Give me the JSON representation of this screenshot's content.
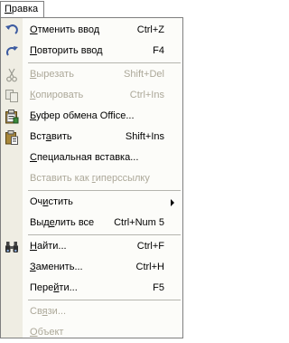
{
  "menu_title": "Правка",
  "menu_title_accel": "П",
  "menu_title_rest": "равка",
  "items": [
    {
      "type": "item",
      "pre": "",
      "accel": "О",
      "post": "тменить ввод",
      "shortcut": "Ctrl+Z",
      "icon": "undo-icon",
      "enabled": true
    },
    {
      "type": "item",
      "pre": "",
      "accel": "П",
      "post": "овторить ввод",
      "shortcut": "F4",
      "icon": "redo-icon",
      "enabled": true
    },
    {
      "type": "sep"
    },
    {
      "type": "item",
      "pre": "",
      "accel": "В",
      "post": "ырезать",
      "shortcut": "Shift+Del",
      "icon": "cut-icon",
      "enabled": false
    },
    {
      "type": "item",
      "pre": "",
      "accel": "К",
      "post": "опировать",
      "shortcut": "Ctrl+Ins",
      "icon": "copy-icon",
      "enabled": false
    },
    {
      "type": "item",
      "pre": "",
      "accel": "Б",
      "post": "уфер обмена Office...",
      "shortcut": "",
      "icon": "clipboard-icon",
      "enabled": true
    },
    {
      "type": "item",
      "pre": "Вст",
      "accel": "а",
      "post": "вить",
      "shortcut": "Shift+Ins",
      "icon": "paste-icon",
      "enabled": true
    },
    {
      "type": "item",
      "pre": "",
      "accel": "С",
      "post": "пециальная вставка...",
      "shortcut": "",
      "icon": "",
      "enabled": true
    },
    {
      "type": "item",
      "pre": "Вставить как ",
      "accel": "г",
      "post": "иперссылку",
      "shortcut": "",
      "icon": "",
      "enabled": false
    },
    {
      "type": "sep"
    },
    {
      "type": "item",
      "pre": "Оч",
      "accel": "и",
      "post": "стить",
      "shortcut": "",
      "icon": "",
      "enabled": true,
      "submenu": true
    },
    {
      "type": "item",
      "pre": "Выд",
      "accel": "е",
      "post": "лить все",
      "shortcut": "Ctrl+Num 5",
      "icon": "",
      "enabled": true
    },
    {
      "type": "sep"
    },
    {
      "type": "item",
      "pre": "",
      "accel": "Н",
      "post": "айти...",
      "shortcut": "Ctrl+F",
      "icon": "binoculars-icon",
      "enabled": true
    },
    {
      "type": "item",
      "pre": "",
      "accel": "З",
      "post": "аменить...",
      "shortcut": "Ctrl+H",
      "icon": "",
      "enabled": true
    },
    {
      "type": "item",
      "pre": "Пере",
      "accel": "й",
      "post": "ти...",
      "shortcut": "F5",
      "icon": "",
      "enabled": true
    },
    {
      "type": "sep"
    },
    {
      "type": "item",
      "pre": "Св",
      "accel": "я",
      "post": "зи...",
      "shortcut": "",
      "icon": "",
      "enabled": false
    },
    {
      "type": "item",
      "pre": "",
      "accel": "О",
      "post": "бъект",
      "shortcut": "",
      "icon": "",
      "enabled": false
    }
  ],
  "colors": {
    "gutter": "#efede3",
    "menu_bg": "#fcfcf9",
    "disabled_text": "#aca899",
    "border": "#7f7f7f"
  }
}
